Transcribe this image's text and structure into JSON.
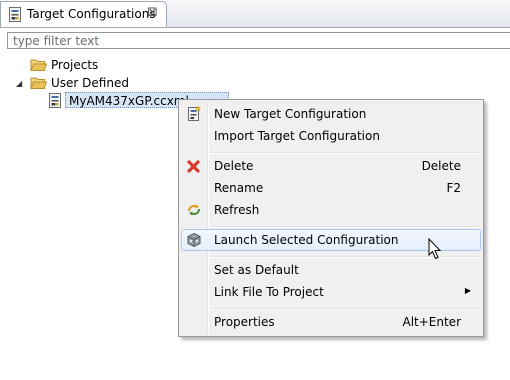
{
  "view": {
    "tab_title": "Target Configurations",
    "close_glyph": "⊠",
    "icons": {
      "tab": "target-config-icon",
      "close": "close-icon"
    }
  },
  "filter": {
    "placeholder": "type filter text",
    "value": ""
  },
  "tree": {
    "items": [
      {
        "label": "Projects",
        "icon": "folder-icon",
        "expanded": false
      },
      {
        "label": "User Defined",
        "icon": "folder-open-icon",
        "expanded": true
      },
      {
        "label": "MyAM437xGP.ccxml",
        "icon": "ccxml-file-icon",
        "selected": true
      }
    ]
  },
  "context_menu": {
    "items": [
      {
        "label": "New Target Configuration",
        "accel": "",
        "icon": "new-target-config-icon"
      },
      {
        "label": "Import Target Configuration",
        "accel": "",
        "icon": ""
      },
      {
        "label": "Delete",
        "accel": "Delete",
        "icon": "delete-icon",
        "color": "#d53a2a"
      },
      {
        "label": "Rename",
        "accel": "F2",
        "icon": ""
      },
      {
        "label": "Refresh",
        "accel": "",
        "icon": "refresh-icon"
      },
      {
        "label": "Launch Selected Configuration",
        "accel": "",
        "icon": "launch-debug-icon",
        "highlighted": true
      },
      {
        "label": "Set as Default",
        "accel": "",
        "icon": ""
      },
      {
        "label": "Link File To Project",
        "accel": "",
        "icon": "",
        "submenu_glyph": "▶"
      },
      {
        "label": "Properties",
        "accel": "Alt+Enter",
        "icon": ""
      }
    ]
  },
  "colors": {
    "selection_bg": "#d6e6f7",
    "menu_bg": "#f0f0f0",
    "menu_hover_border": "#a8c8ef",
    "folder": "#e8c15b"
  }
}
